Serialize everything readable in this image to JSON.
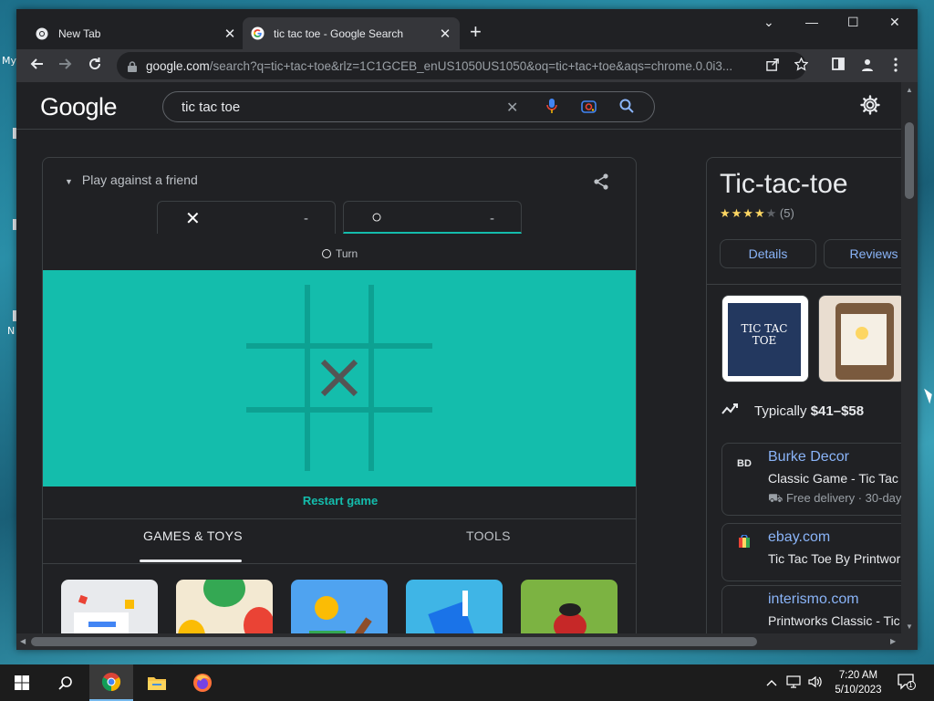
{
  "desktop": {
    "icon_label_1": "My",
    "icon_label_2": "N"
  },
  "browser": {
    "tabs": [
      {
        "title": "New Tab",
        "close": "✕"
      },
      {
        "title": "tic tac toe - Google Search",
        "close": "✕"
      }
    ],
    "new_tab": "+",
    "window_controls": {
      "list": "⌄",
      "minimize": "—",
      "maximize": "☐",
      "close": "✕"
    },
    "url_host": "google.com",
    "url_path": "/search?q=tic+tac+toe&rlz=1C1GCEB_enUS1050US1050&oq=tic+tac+toe&aqs=chrome.0.0i3..."
  },
  "google": {
    "logo": "Google",
    "query": "tic tac toe",
    "clear": "✕"
  },
  "game": {
    "mode_label": "Play against a friend",
    "player_x": {
      "symbol": "✕",
      "score": "-"
    },
    "player_o": {
      "symbol": "○",
      "score": "-"
    },
    "turn_label": "Turn",
    "board": [
      "",
      "",
      "",
      "",
      "X",
      "",
      "",
      "",
      ""
    ],
    "restart": "Restart game",
    "tabs": [
      "GAMES & TOYS",
      "TOOLS"
    ],
    "active_tab": "GAMES & TOYS",
    "board_color": "#14bdac",
    "accent": "#14bcac"
  },
  "knowledge_panel": {
    "title": "Tic-tac-toe",
    "stars": "★★★★",
    "half_star": "★",
    "rating_count": "(5)",
    "buttons": [
      "Details",
      "Reviews"
    ],
    "product_image_text": "TIC TAC TOE",
    "price_prefix": "Typically",
    "price_range": "$41–$58",
    "merchants": [
      {
        "logo": "BD",
        "name": "Burke Decor",
        "desc": "Classic Game - Tic Tac T",
        "delivery": "Free delivery · 30-day"
      },
      {
        "logo": "",
        "name": "ebay.com",
        "desc": "Tic Tac Toe By Printwork",
        "delivery": ""
      },
      {
        "logo": "",
        "name": "interismo.com",
        "desc": "Printworks Classic - Tic",
        "delivery": ""
      }
    ]
  },
  "taskbar": {
    "time": "7:20 AM",
    "date": "5/10/2023",
    "notification_count": "1"
  }
}
